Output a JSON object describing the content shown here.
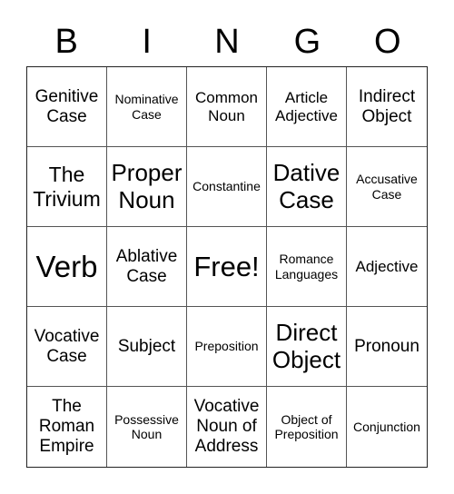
{
  "header": {
    "letters": [
      "B",
      "I",
      "N",
      "G",
      "O"
    ]
  },
  "board": {
    "rows": [
      [
        "Genitive Case",
        "Nominative Case",
        "Common Noun",
        "Article Adjective",
        "Indirect Object"
      ],
      [
        "The Trivium",
        "Proper Noun",
        "Constantine",
        "Dative Case",
        "Accusative Case"
      ],
      [
        "Verb",
        "Ablative Case",
        "Free!",
        "Romance Languages",
        "Adjective"
      ],
      [
        "Vocative Case",
        "Subject",
        "Preposition",
        "Direct Object",
        "Pronoun"
      ],
      [
        "The Roman Empire",
        "Possessive Noun",
        "Vocative Noun of Address",
        "Object of Preposition",
        "Conjunction"
      ]
    ]
  }
}
